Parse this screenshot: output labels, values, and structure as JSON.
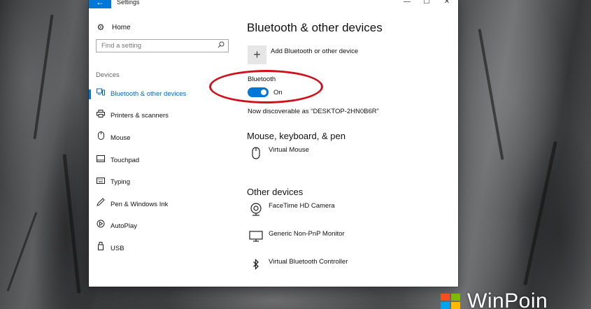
{
  "window": {
    "title": "Settings",
    "back_glyph": "←",
    "controls": {
      "minimize": "—",
      "maximize": "☐",
      "close": "✕"
    }
  },
  "sidebar": {
    "home": {
      "label": "Home",
      "icon": "gear-icon"
    },
    "search": {
      "placeholder": "Find a setting",
      "icon": "search-icon"
    },
    "section_label": "Devices",
    "items": [
      {
        "label": "Bluetooth & other devices",
        "icon": "bluetooth-devices-icon",
        "selected": true
      },
      {
        "label": "Printers & scanners",
        "icon": "printer-icon",
        "selected": false
      },
      {
        "label": "Mouse",
        "icon": "mouse-icon",
        "selected": false
      },
      {
        "label": "Touchpad",
        "icon": "touchpad-icon",
        "selected": false
      },
      {
        "label": "Typing",
        "icon": "keyboard-icon",
        "selected": false
      },
      {
        "label": "Pen & Windows Ink",
        "icon": "pen-icon",
        "selected": false
      },
      {
        "label": "AutoPlay",
        "icon": "autoplay-icon",
        "selected": false
      },
      {
        "label": "USB",
        "icon": "usb-icon",
        "selected": false
      }
    ]
  },
  "main": {
    "title": "Bluetooth & other devices",
    "add_button_glyph": "+",
    "add_label": "Add Bluetooth or other device",
    "bluetooth": {
      "label": "Bluetooth",
      "state": "On",
      "enabled": true
    },
    "discoverable": "Now discoverable as “DESKTOP-2HN0B6R”",
    "mouse_section": {
      "title": "Mouse, keyboard, & pen",
      "devices": [
        {
          "label": "Virtual Mouse",
          "icon": "mouse-icon"
        }
      ]
    },
    "other_section": {
      "title": "Other devices",
      "devices": [
        {
          "label": "FaceTime HD Camera",
          "icon": "webcam-icon"
        },
        {
          "label": "Generic Non-PnP Monitor",
          "icon": "monitor-icon"
        },
        {
          "label": "Virtual Bluetooth Controller",
          "icon": "bluetooth-icon"
        }
      ]
    }
  },
  "annotation": {
    "color": "#d0111b"
  },
  "colors": {
    "accent": "#0078d7"
  },
  "watermark": {
    "text": "WinPoin"
  }
}
